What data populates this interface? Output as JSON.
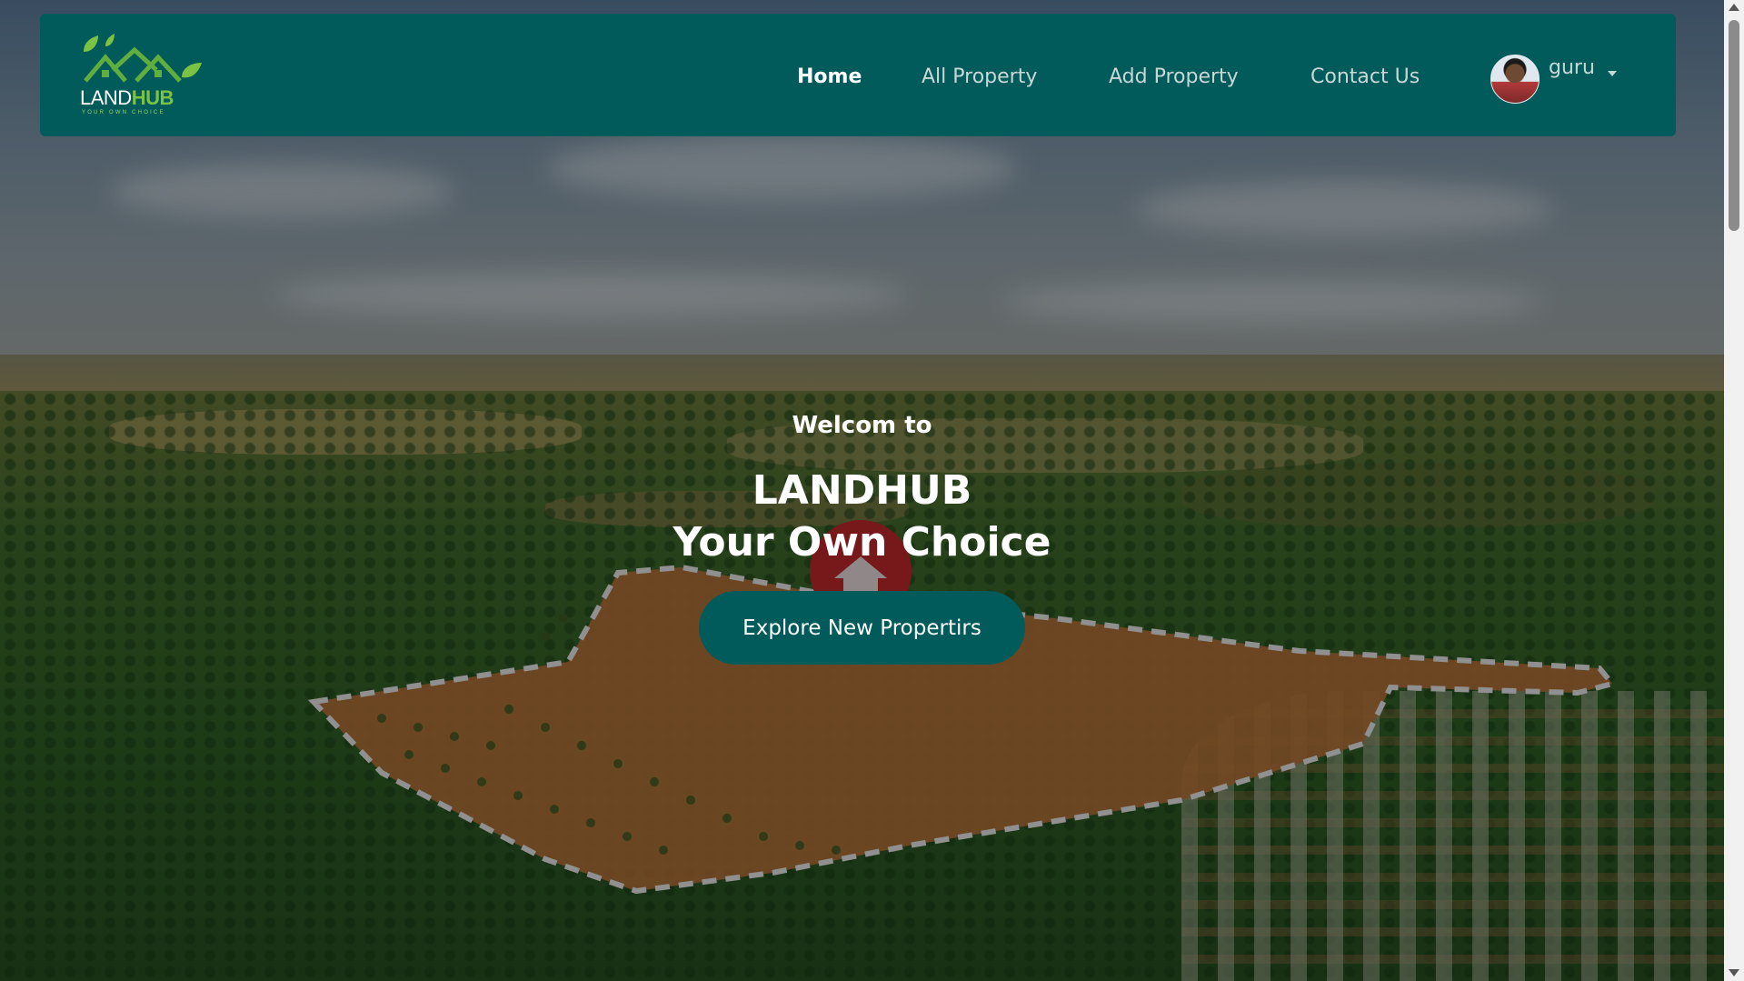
{
  "navbar": {
    "logo": {
      "name": "LANDHUB",
      "part1": "LAND",
      "part2": "HUB",
      "tagline": "YOUR OWN CHOICE"
    },
    "links": [
      {
        "label": "Home",
        "active": true
      },
      {
        "label": "All Property",
        "active": false
      },
      {
        "label": "Add Property",
        "active": false
      },
      {
        "label": "Contact Us",
        "active": false
      }
    ],
    "user": {
      "name": "guru"
    }
  },
  "hero": {
    "welcome": "Welcom to",
    "title_line1": "LANDHUB",
    "title_line2": "Your Own Choice",
    "cta_label": "Explore New Propertirs"
  },
  "colors": {
    "brand_teal": "#005b5a",
    "logo_green": "#7cc243",
    "nav_text": "#c6d8d7",
    "plot_orange": "#b9733a",
    "pin_red": "#c1272d"
  },
  "icons": {
    "logo": "house-roof-leaves-icon",
    "pin": "map-pin-house-icon",
    "caret": "caret-down-icon"
  }
}
